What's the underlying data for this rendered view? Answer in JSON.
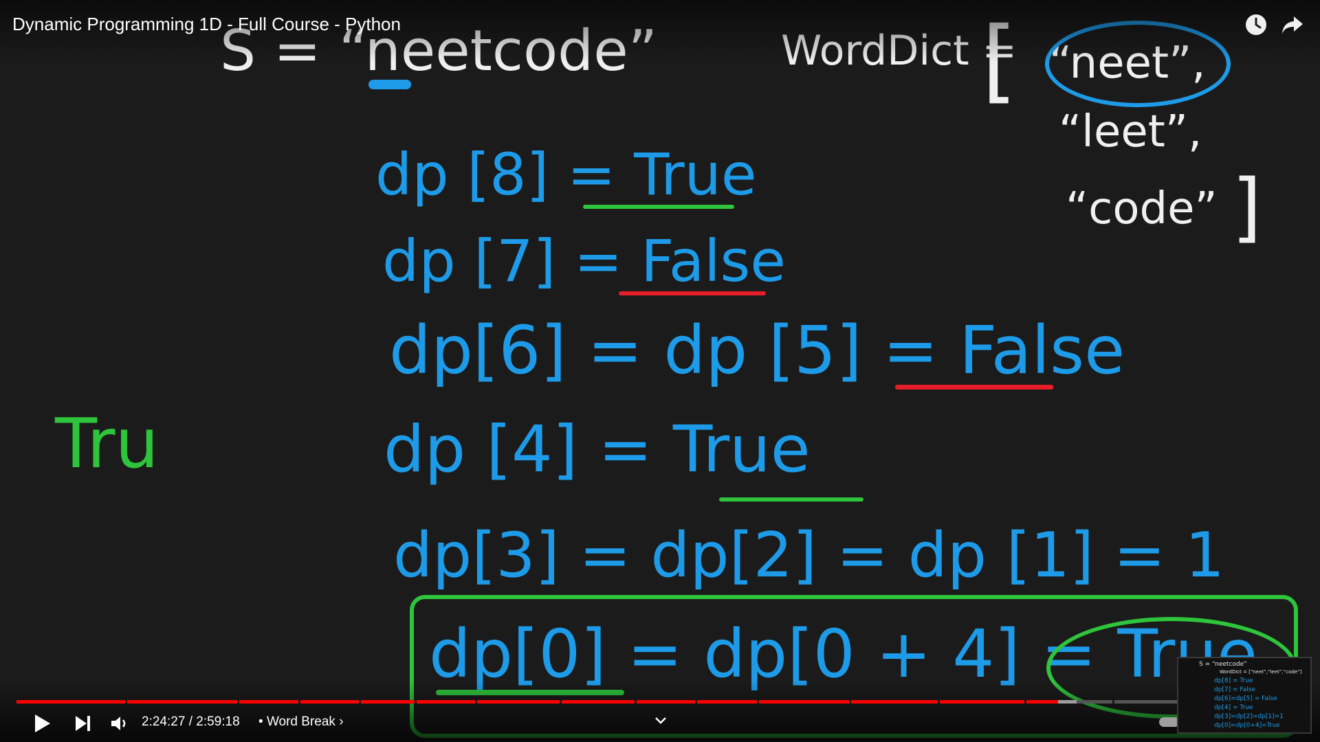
{
  "video": {
    "title": "Dynamic Programming 1D - Full Course - Python",
    "time_current": "2:24:27",
    "time_separator": "/",
    "time_total": "2:59:18",
    "chapter_sep": "•",
    "chapter": "Word Break",
    "chapter_arrow": "›",
    "progress": 0.806,
    "colors": {
      "played": "#ff0000",
      "buffered": "#9e9e9e",
      "track": "#555555"
    }
  },
  "board": {
    "s_line": "S = “neetcode”",
    "worddict_label": "WordDict =",
    "open_bracket": "[",
    "words": [
      "“neet”,",
      "“leet”,",
      "“code”"
    ],
    "close_bracket": "]",
    "lines": [
      "dp [8] = True",
      "dp [7] = False",
      "dp[6] = dp [5] = False",
      "dp [4] = True",
      "dp[3] = dp[2] = dp [1] = 1",
      "dp[0] = dp[0 + 4] = True"
    ],
    "side_note": "Tru",
    "colors": {
      "ink_blue": "#1e9be8",
      "ink_white": "#f0f0f0",
      "ink_green": "#2ec43c",
      "ink_red": "#e51e2a"
    }
  },
  "thumbnail": {
    "s_line": "S = “neetcode”",
    "dict": "WordDict = [“neet”,“leet”,“code”]",
    "lines": [
      "dp[8] = True",
      "dp[7] = False",
      "dp[6]=dp[5] = False",
      "dp[4] = True",
      "dp[3]=dp[2]=dp[1]=1",
      "dp[0]=dp[0+4]=True"
    ]
  }
}
